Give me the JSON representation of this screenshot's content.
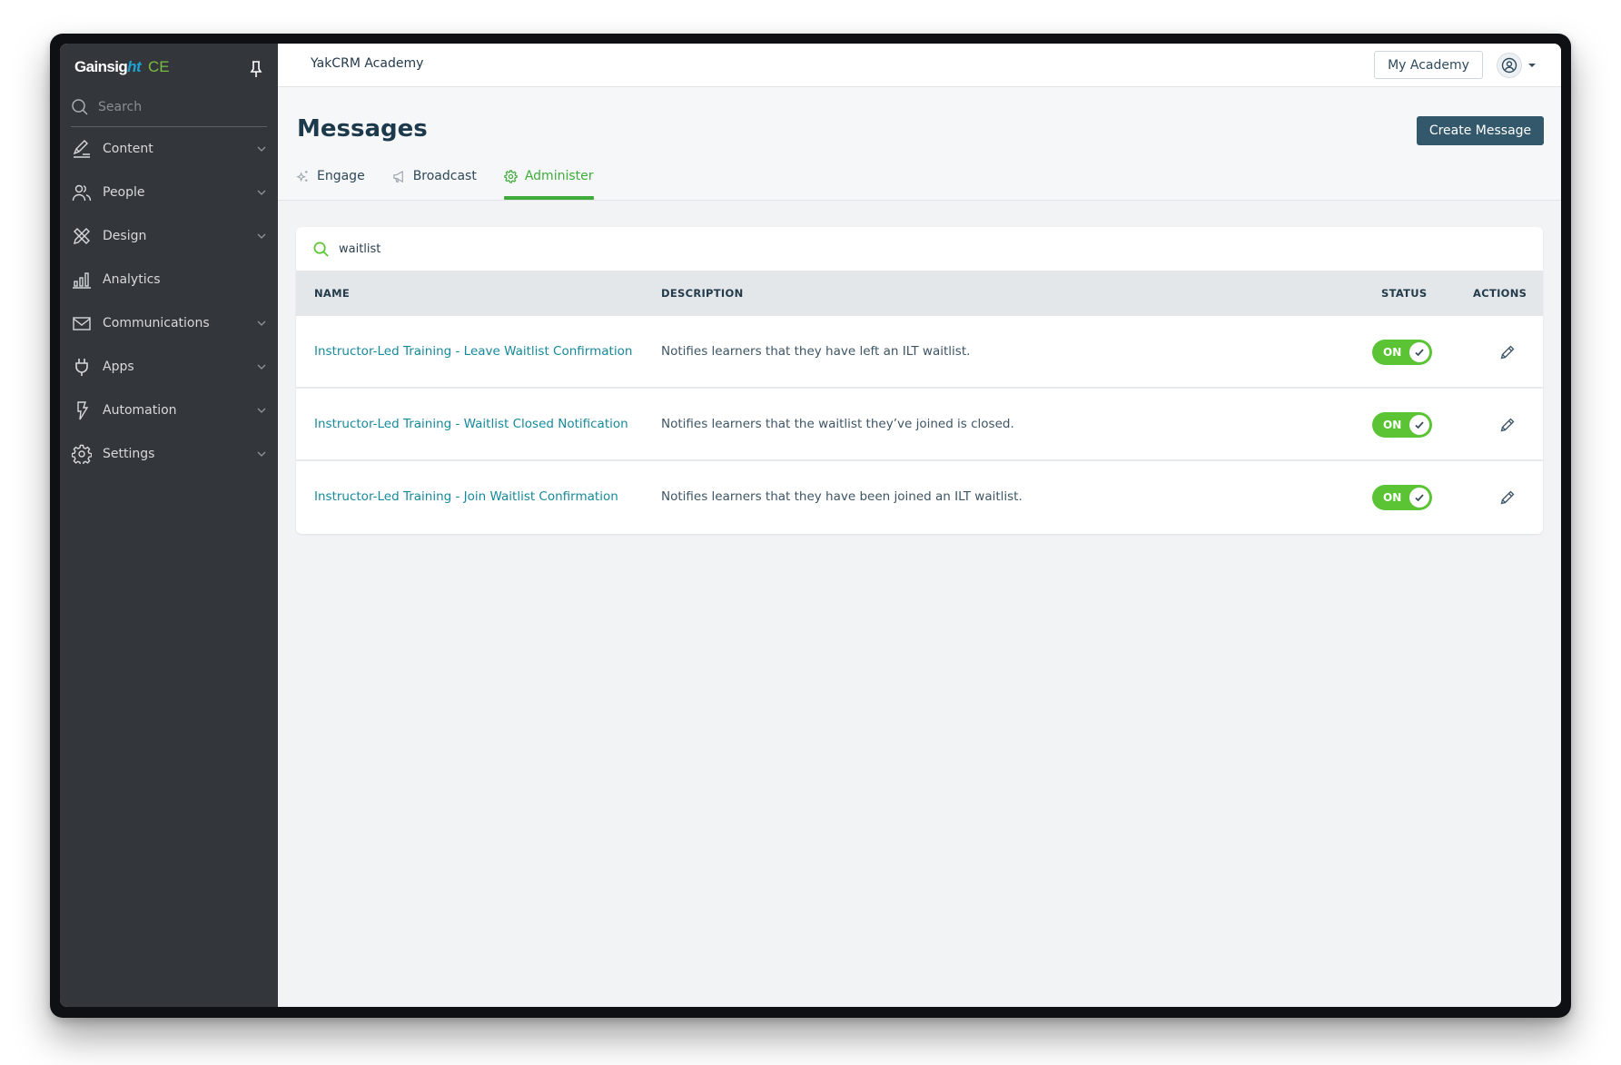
{
  "sidebar": {
    "logo_main": "Gainsig",
    "logo_accent": "ht",
    "logo_suffix": "CE",
    "pin_icon": "pin-icon",
    "search_placeholder": "Search",
    "items": [
      {
        "label": "Content",
        "icon": "pen-icon",
        "expandable": true
      },
      {
        "label": "People",
        "icon": "people-icon",
        "expandable": true
      },
      {
        "label": "Design",
        "icon": "design-tools-icon",
        "expandable": true
      },
      {
        "label": "Analytics",
        "icon": "bar-chart-icon",
        "expandable": false
      },
      {
        "label": "Communications",
        "icon": "envelope-icon",
        "expandable": true
      },
      {
        "label": "Apps",
        "icon": "plug-icon",
        "expandable": true
      },
      {
        "label": "Automation",
        "icon": "lightning-icon",
        "expandable": true
      },
      {
        "label": "Settings",
        "icon": "gear-icon",
        "expandable": true
      }
    ]
  },
  "topbar": {
    "community_name": "YakCRM Academy",
    "my_academy_label": "My Academy",
    "avatar_icon": "user-circle-icon"
  },
  "page": {
    "title": "Messages",
    "create_button_label": "Create Message",
    "tabs": [
      {
        "label": "Engage",
        "icon": "sparkle-icon",
        "active": false
      },
      {
        "label": "Broadcast",
        "icon": "megaphone-icon",
        "active": false
      },
      {
        "label": "Administer",
        "icon": "gear-icon",
        "active": true
      }
    ]
  },
  "table": {
    "search_value": "waitlist",
    "columns": {
      "name": "NAME",
      "description": "DESCRIPTION",
      "status": "STATUS",
      "actions": "ACTIONS"
    },
    "rows": [
      {
        "name": "Instructor-Led Training - Leave Waitlist Confirmation",
        "description": "Notifies learners that they have left an ILT waitlist.",
        "status": "ON",
        "enabled": true
      },
      {
        "name": "Instructor-Led Training - Waitlist Closed Notification",
        "description": "Notifies learners that the waitlist they’ve joined is closed.",
        "status": "ON",
        "enabled": true
      },
      {
        "name": "Instructor-Led Training - Join Waitlist Confirmation",
        "description": "Notifies learners that they have been joined an ILT waitlist.",
        "status": "ON",
        "enabled": true
      }
    ]
  },
  "colors": {
    "sidebar_bg": "#33373b",
    "accent_green": "#3fab3a",
    "toggle_green": "#5bc434",
    "link_teal": "#16899a",
    "primary_button": "#33586b"
  }
}
